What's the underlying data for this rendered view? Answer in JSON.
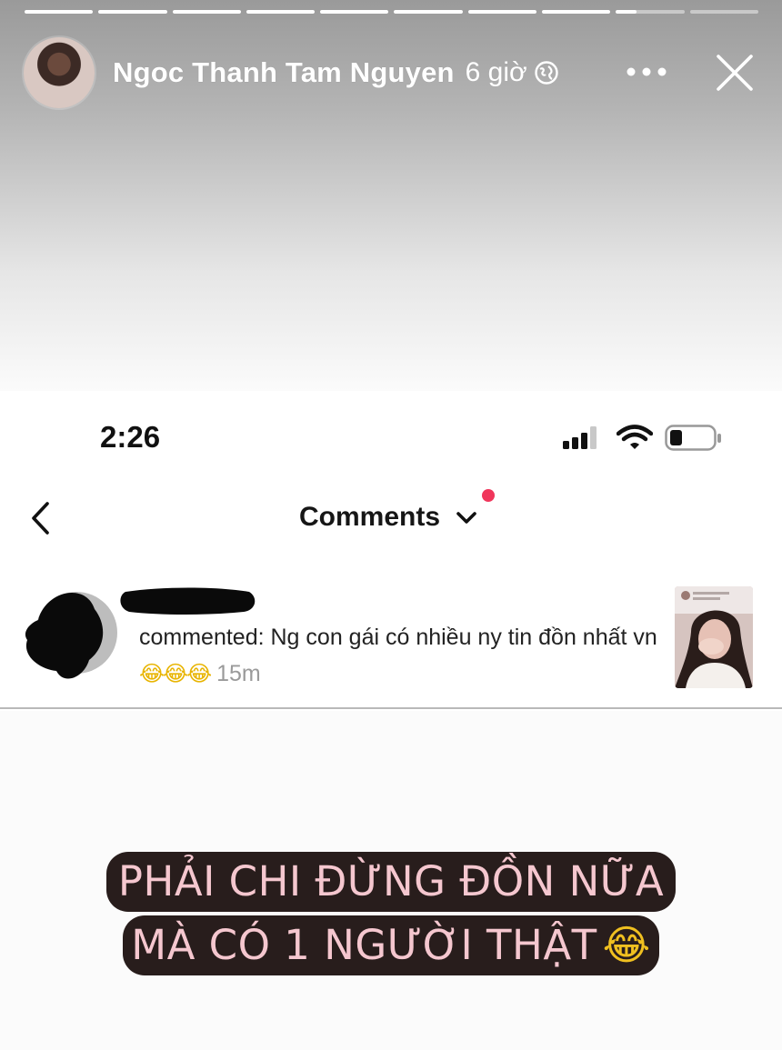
{
  "story": {
    "user_name": "Ngoc Thanh Tam Nguyen",
    "time_ago": "6 giờ",
    "progress_segments": [
      1,
      1,
      1,
      1,
      1,
      1,
      1,
      1,
      0.3,
      0
    ]
  },
  "phone_status": {
    "time": "2:26"
  },
  "comments_screen": {
    "title": "Comments",
    "comment": {
      "text": "commented: Ng con gái có nhiều ny tin đồn nhất vn",
      "emoji": "😂😂😂",
      "time": "15m"
    }
  },
  "caption": {
    "line1": "PHẢI CHI ĐỪNG ĐỒN NỮA",
    "line2": "MÀ CÓ 1 NGƯỜI THẬT",
    "emoji": "😂"
  },
  "colors": {
    "notification_dot": "#f0365b",
    "caption_bg": "#281d1c",
    "caption_text": "#f5c7cf"
  }
}
